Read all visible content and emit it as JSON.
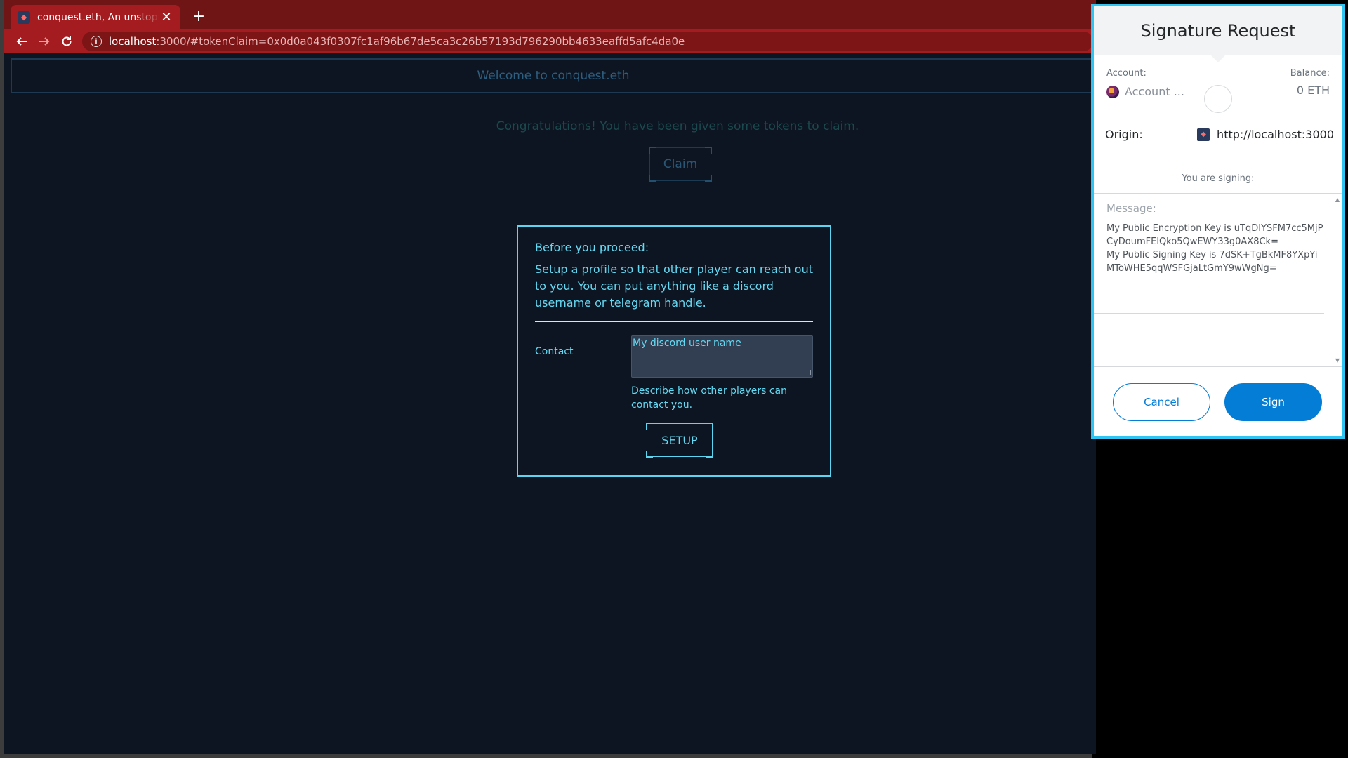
{
  "browser": {
    "tab_title": "conquest.eth, An unstoppable",
    "tab_close": "✕",
    "new_tab": "+",
    "url_host": "localhost",
    "url_path": ":3000/#tokenClaim=0x0d0a043f0307fc1af96b67de5ca3c26b57193d796290bb4633eaffd5afc4da0e"
  },
  "page": {
    "welcome": "Welcome to conquest.eth",
    "congrats": "Congratulations! You have been given some tokens to claim.",
    "claim_label": "Claim"
  },
  "modal": {
    "heading": "Before you proceed:",
    "description": "Setup a profile so that other player can reach out to you. You can put anything like a discord username or telegram handle.",
    "contact_label": "Contact",
    "contact_placeholder": "My discord user name",
    "contact_help": "Describe how other players can contact you.",
    "setup_label": "SETUP"
  },
  "signature": {
    "title": "Signature Request",
    "account_label": "Account:",
    "account_name": "Account ...",
    "balance_label": "Balance:",
    "balance_value": "0 ETH",
    "origin_label": "Origin:",
    "origin_value": "http://localhost:3000",
    "signing_label": "You are signing:",
    "message_label": "Message:",
    "message_line1": "My Public Encryption Key is uTqDIYSFM7cc5MjPCyDoumFElQko5QwEWY33g0AX8Ck=",
    "message_line2": "My Public Signing Key is 7dSK+TgBkMF8YXpYiMToWHE5qqWSFGjaLtGmY9wWgNg=",
    "cancel_label": "Cancel",
    "sign_label": "Sign"
  },
  "icons": {
    "back": "back-arrow-icon",
    "forward": "forward-arrow-icon",
    "reload": "reload-icon",
    "info": "info-icon"
  },
  "colors": {
    "tab_active": "#a41c1f",
    "tabbar": "#701516",
    "accent": "#5cd6f0",
    "metamask_blue": "#037dd6"
  }
}
